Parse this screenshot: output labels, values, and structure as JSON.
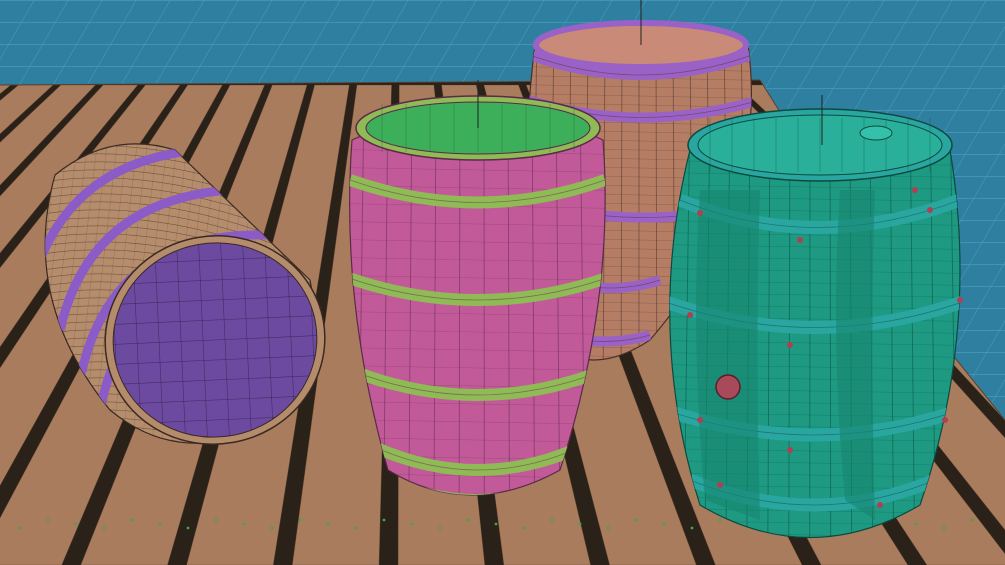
{
  "viewport": {
    "label": "",
    "background_color": "#2f7fa0",
    "grid_line_color": "#4fa3c4"
  },
  "deck": {
    "plank_color": "#a87c5d",
    "gap_color": "#2a2118",
    "wire_color": "#5a4030"
  },
  "barrels": [
    {
      "name": "barrel-lying-purple",
      "body_color": "#b58d6c",
      "end_color": "#6b4aa0",
      "hoop_color": "#8b5cc8",
      "wire_color": "#3a2a20"
    },
    {
      "name": "barrel-back-brown",
      "body_color": "#b47d64",
      "top_color": "#c98a78",
      "hoop_color": "#9a62c6",
      "wire_color": "#4a3028"
    },
    {
      "name": "barrel-pink",
      "body_color": "#c25a9a",
      "top_color": "#3dae5a",
      "hoop_color": "#8fba55",
      "wire_color": "#5a2a48"
    },
    {
      "name": "barrel-teal",
      "body_color": "#1e9a82",
      "top_color": "#2ab09a",
      "hoop_color": "#2aa6a0",
      "wire_color": "#0c4a40",
      "bung_color": "#a84a5a",
      "rivet_color": "#b04050"
    }
  ]
}
